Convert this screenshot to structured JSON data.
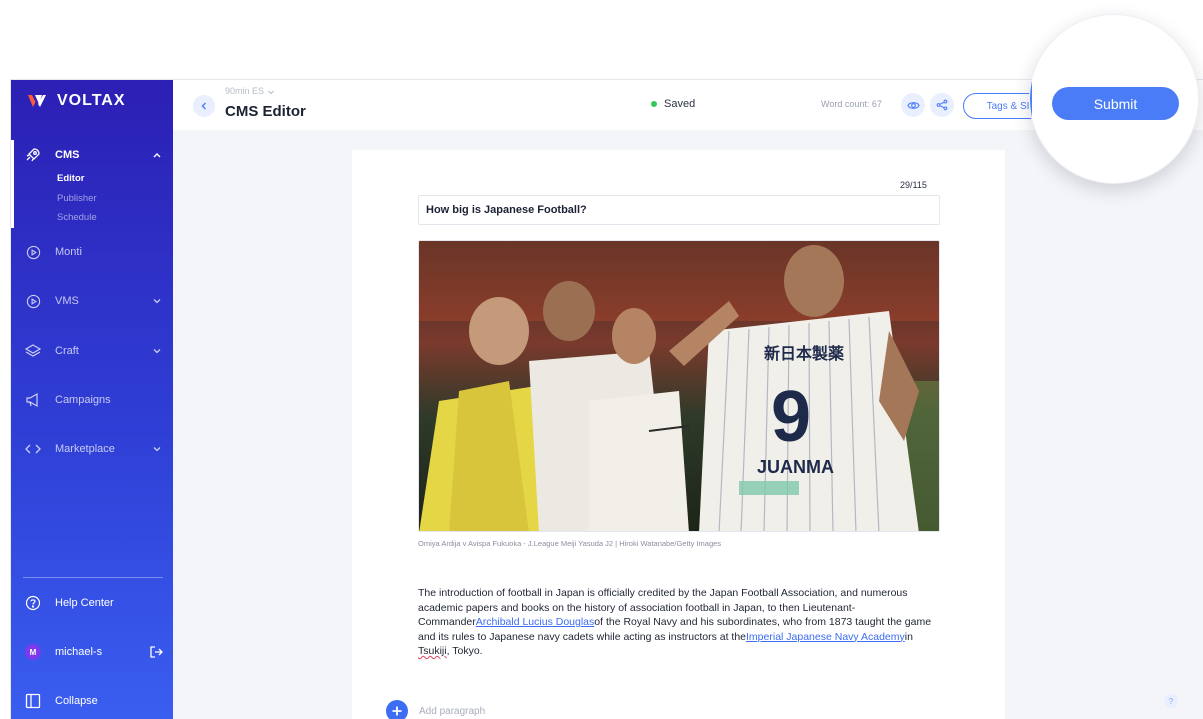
{
  "brand": {
    "name": "VOLTAX"
  },
  "sidebar": {
    "items": [
      {
        "label": "CMS",
        "icon": "rocket-icon"
      },
      {
        "label": "Monti",
        "icon": "play-circle-icon"
      },
      {
        "label": "VMS",
        "icon": "play-circle-icon"
      },
      {
        "label": "Craft",
        "icon": "layers-icon"
      },
      {
        "label": "Campaigns",
        "icon": "megaphone-icon"
      },
      {
        "label": "Marketplace",
        "icon": "code-icon"
      }
    ],
    "cms_sub": [
      "Editor",
      "Publisher",
      "Schedule"
    ],
    "bottom": {
      "help": "Help Center",
      "user": "michael-s",
      "user_initial": "M",
      "collapse": "Collapse"
    }
  },
  "topbar": {
    "site": "90min ES",
    "title": "CMS Editor",
    "status": "Saved",
    "word_count": "Word count: 67",
    "tags_label": "Tags & SI",
    "submit_label": "Submit"
  },
  "editor": {
    "counter": "29/115",
    "headline": "How big is Japanese Football?",
    "caption": "Omiya Ardija v Avispa Fukuoka - J.League Meiji Yasuda J2 | Hiroki Watanabe/Getty Images",
    "body": {
      "p1": "The introduction of football in Japan is officially credited by the Japan Football Association, and numerous academic papers and books on the history of association football in Japan, to then Lieutenant-Commander",
      "link1": "Archibald Lucius Douglas",
      "p2": "of the Royal Navy and his subordinates, who from 1873 taught the game and its rules to Japanese navy cadets while acting as instructors at the",
      "link2": "Imperial Japanese Navy Academy",
      "p3": "in ",
      "link3": "Tsukiji",
      "p4": ", Tokyo."
    },
    "add_paragraph": "Add paragraph"
  },
  "colors": {
    "accent": "#4b7cf7",
    "sidebar_top": "#2c1fb4",
    "sidebar_bottom": "#3a5ef0",
    "saved_dot": "#35c759"
  }
}
